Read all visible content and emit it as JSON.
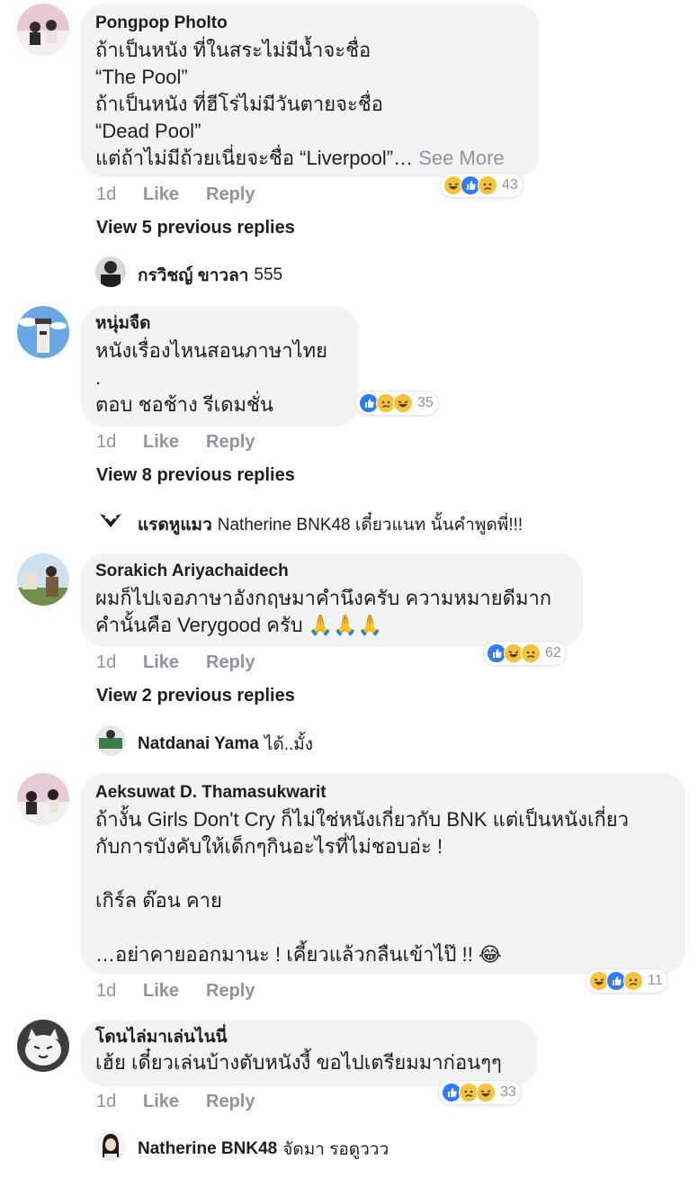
{
  "comments": [
    {
      "author": "Pongpop Pholto",
      "lines": "ถ้าเป็นหนัง ที่ในสระไม่มีน้ำจะชื่อ\n“The Pool”\nถ้าเป็นหนัง ที่ฮีโร่ไม่มีวันตายจะชื่อ\n“Dead Pool”\nแต่ถ้าไม่มีถ้วยเนี่ยจะชื่อ “Liverpool”…",
      "see_more": "See More",
      "time": "1d",
      "like": "Like",
      "reply": "Reply",
      "reactions": [
        "haha",
        "like",
        "sad"
      ],
      "reaction_count": "43",
      "view_previous": "View 5 previous replies",
      "reply_author": "กรวิชญ์ ขาวลา",
      "reply_text": "555"
    },
    {
      "author": "หนุ่มจืด",
      "lines": "หนังเรื่องไหนสอนภาษาไทย\n.\nตอบ ชอช้าง รีเดมชั่น",
      "time": "1d",
      "like": "Like",
      "reply": "Reply",
      "reactions": [
        "like",
        "sad",
        "haha"
      ],
      "reaction_count": "35",
      "view_previous": "View 8 previous replies",
      "reply_author": "แรดหูแมว",
      "reply_text": "Natherine BNK48 เดี๋ยวแนท นั้นคำพูดพี่!!!"
    },
    {
      "author": "Sorakich Ariyachaidech",
      "lines": "ผมก็ไปเจอภาษาอังกฤษมาคำนึงครับ ความหมายดีมาก\nคำนั้นคือ Verygood ครับ 🙏🙏🙏",
      "time": "1d",
      "like": "Like",
      "reply": "Reply",
      "reactions": [
        "like",
        "haha",
        "sad"
      ],
      "reaction_count": "62",
      "view_previous": "View 2 previous replies",
      "reply_author": "Natdanai Yama",
      "reply_text": "ได้..มั้ง"
    },
    {
      "author": "Aeksuwat D. Thamasukwarit",
      "lines": "ถ้างั้น Girls Don't Cry ก็ไม่ใช่หนังเกี่ยวกับ BNK แต่เป็นหนังเกี่ยว\nกับการบังคับให้เด็กๆกินอะไรที่ไม่ชอบอ่ะ !\n\nเกิร์ล ด๊อน คาย\n\n…อย่าคายออกมานะ ! เคี้ยวแล้วกลืนเข้าไป๊ !! 😂",
      "time": "1d",
      "like": "Like",
      "reply": "Reply",
      "reactions": [
        "haha",
        "like",
        "sad"
      ],
      "reaction_count": "11"
    },
    {
      "author": "โดนไล่มาเล่นไนนี่",
      "lines": "เฮ้ย เดี๋ยวเล่นบ้างตับหนังงี้ ขอไปเตรียมมาก่อนๆๆ",
      "time": "1d",
      "like": "Like",
      "reply": "Reply",
      "reactions": [
        "like",
        "sad",
        "haha"
      ],
      "reaction_count": "33",
      "reply_author": "Natherine BNK48",
      "reply_text": "จัดมา รอดูววว"
    }
  ],
  "colors": {
    "bubble": "#f2f3f5",
    "meta": "#90949c",
    "like_blue": "#2f7cf6",
    "emoji_yellow": "#f7c33b"
  }
}
